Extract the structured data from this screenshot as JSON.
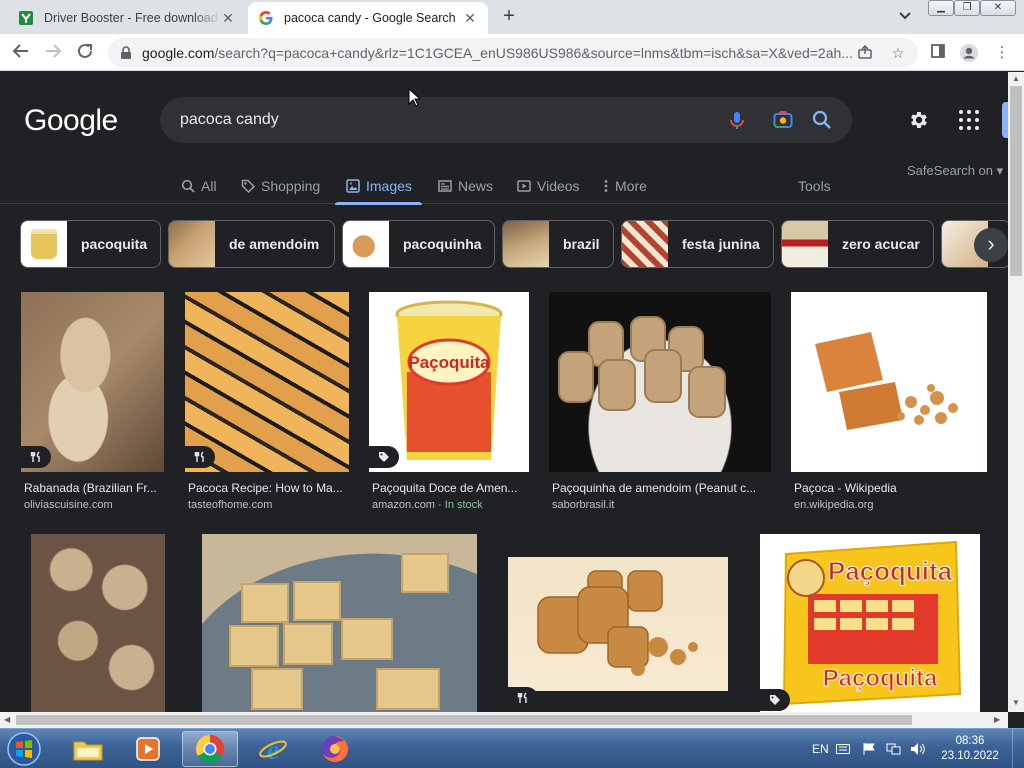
{
  "browser": {
    "tabs": [
      {
        "title": "Driver Booster - Free download a",
        "icon": "driver-booster-favicon",
        "active": false
      },
      {
        "title": "pacoca candy - Google Search",
        "icon": "google-favicon",
        "active": true
      }
    ],
    "url_host": "google.com",
    "url_rest": "/search?q=pacoca+candy&rlz=1C1GCEA_enUS986US986&source=lnms&tbm=isch&sa=X&ved=2ah..."
  },
  "google": {
    "logo": "Google",
    "query": "pacoca candy",
    "tabs": [
      {
        "label": "All",
        "icon": "search-icon"
      },
      {
        "label": "Shopping",
        "icon": "tag-icon"
      },
      {
        "label": "Images",
        "icon": "image-icon",
        "active": true
      },
      {
        "label": "News",
        "icon": "news-icon"
      },
      {
        "label": "Videos",
        "icon": "video-icon"
      },
      {
        "label": "More",
        "icon": "more-vert-icon"
      }
    ],
    "tools": "Tools",
    "safesearch": "SafeSearch on",
    "chips": [
      {
        "label": "pacoquita",
        "color": "#e8c55a"
      },
      {
        "label": "de amendoim",
        "color": "#c9a172"
      },
      {
        "label": "pacoquinha",
        "color": "#d99a5a"
      },
      {
        "label": "brazil",
        "color": "#c4a67a"
      },
      {
        "label": "festa junina",
        "color": "#b2432f"
      },
      {
        "label": "zero acucar",
        "color": "#d6c9a7"
      }
    ],
    "results": [
      {
        "title": "Rabanada (Brazilian Fr...",
        "source": "oliviascuisine.com",
        "badge": "recipe-icon",
        "bg": "#a8896a"
      },
      {
        "title": "Pacoca Recipe: How to Ma...",
        "source": "tasteofhome.com",
        "badge": "recipe-icon",
        "bg": "#e2a04c"
      },
      {
        "title": "Paçoquita Doce de Amen...",
        "source": "amazon.com",
        "source_extra": "In stock",
        "badge": "tag-icon",
        "bg": "#ffffff"
      },
      {
        "title": "Paçoquinha de amendoim (Peanut c...",
        "source": "saborbrasil.it",
        "badge": "",
        "bg": "#c4a27a"
      },
      {
        "title": "Paçoca - Wikipedia",
        "source": "en.wikipedia.org",
        "badge": "",
        "bg": "#ffffff"
      },
      {
        "title": "",
        "source": "",
        "badge": "",
        "bg": "#6b5443"
      },
      {
        "title": "",
        "source": "",
        "badge": "",
        "bg": "#c9b79a"
      },
      {
        "title": "",
        "source": "",
        "badge": "recipe-icon",
        "bg": "#f3e2c4"
      },
      {
        "title": "",
        "source": "",
        "badge": "tag-icon",
        "bg": "#ffffff"
      }
    ]
  },
  "taskbar": {
    "language": "EN",
    "time": "08:36",
    "date": "23.10.2022"
  }
}
